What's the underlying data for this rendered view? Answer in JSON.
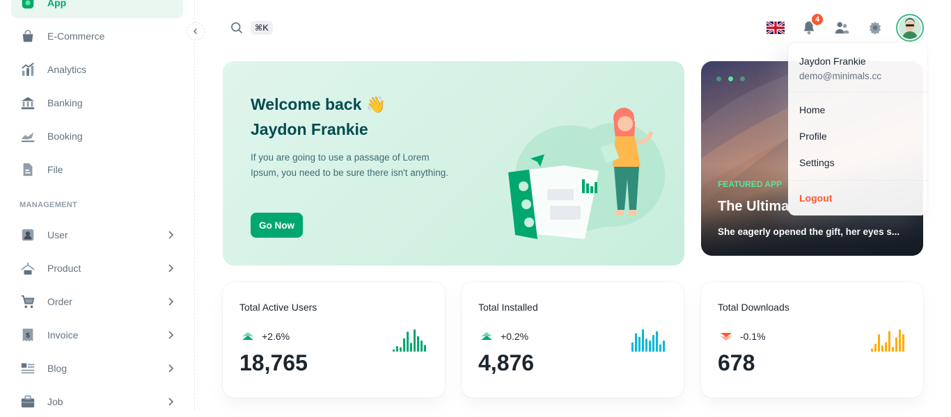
{
  "sidebar": {
    "items": [
      {
        "label": "App",
        "icon": "app-icon",
        "active": true
      },
      {
        "label": "E-Commerce",
        "icon": "bag-icon"
      },
      {
        "label": "Analytics",
        "icon": "analytics-icon"
      },
      {
        "label": "Banking",
        "icon": "bank-icon"
      },
      {
        "label": "Booking",
        "icon": "booking-icon"
      },
      {
        "label": "File",
        "icon": "file-icon"
      }
    ],
    "subheader": "MANAGEMENT",
    "management": [
      {
        "label": "User",
        "icon": "user-icon"
      },
      {
        "label": "Product",
        "icon": "product-icon"
      },
      {
        "label": "Order",
        "icon": "cart-icon"
      },
      {
        "label": "Invoice",
        "icon": "invoice-icon"
      },
      {
        "label": "Blog",
        "icon": "blog-icon"
      },
      {
        "label": "Job",
        "icon": "job-icon"
      }
    ]
  },
  "header": {
    "search_shortcut": "⌘K",
    "notification_count": "4"
  },
  "welcome": {
    "title_line1": "Welcome back 👋",
    "title_line2": "Jaydon Frankie",
    "description": "If you are going to use a passage of Lorem Ipsum, you need to be sure there isn't anything.",
    "button": "Go Now"
  },
  "featured": {
    "tag": "FEATURED APP",
    "title": "The Ultima",
    "description": "She eagerly opened the gift, her eyes s..."
  },
  "account_menu": {
    "name": "Jaydon Frankie",
    "email": "demo@minimals.cc",
    "items": [
      "Home",
      "Profile",
      "Settings"
    ],
    "logout": "Logout"
  },
  "stats": [
    {
      "title": "Total Active Users",
      "trend": "+2.6%",
      "direction": "up",
      "value": "18,765",
      "color": "#00a76f",
      "bars": [
        2,
        5,
        4,
        12,
        18,
        8,
        20,
        14,
        10,
        6
      ]
    },
    {
      "title": "Total Installed",
      "trend": "+0.2%",
      "direction": "up",
      "value": "4,876",
      "color": "#00b8d9",
      "bars": [
        10,
        20,
        16,
        24,
        14,
        12,
        18,
        22,
        8,
        12
      ]
    },
    {
      "title": "Total Downloads",
      "trend": "-0.1%",
      "direction": "down",
      "value": "678",
      "color": "#ffab00",
      "bars": [
        4,
        10,
        22,
        8,
        12,
        26,
        6,
        18,
        28,
        22
      ]
    }
  ],
  "colors": {
    "primary": "#00a76f",
    "error": "#ff5630"
  }
}
